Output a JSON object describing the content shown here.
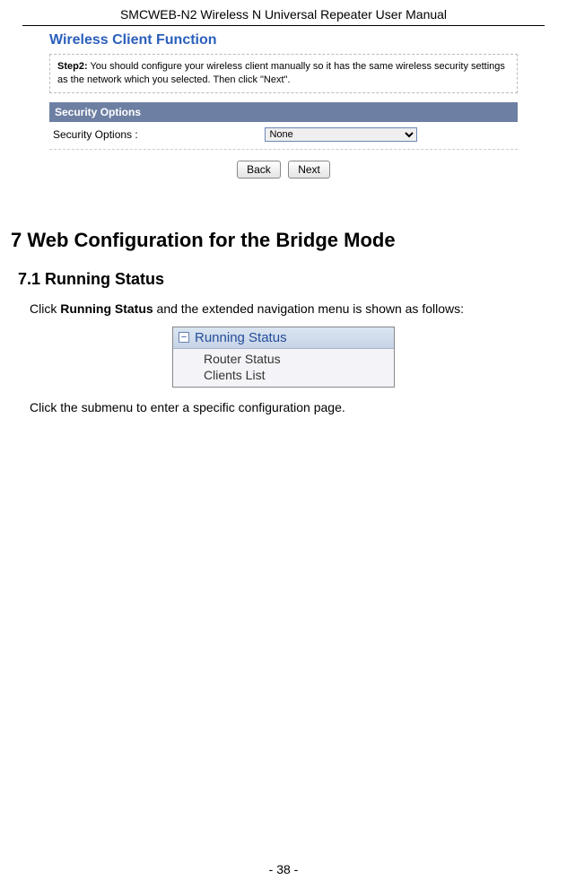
{
  "header": "SMCWEB-N2 Wireless N Universal Repeater User Manual",
  "panel": {
    "title": "Wireless Client Function",
    "stepLabel": "Step2:",
    "stepText": " You should configure your wireless client manually so it has the same wireless security settings as the network which you selected. Then click \"Next\".",
    "secOptionsHead": "Security Options",
    "secOptionsLabel": "Security Options :",
    "secOptionsValue": "None",
    "backBtn": "Back",
    "nextBtn": "Next"
  },
  "section7": {
    "h1": "7    Web Configuration for the Bridge Mode",
    "h2": "7.1   Running Status",
    "p1_a": "Click ",
    "p1_b": "Running Status",
    "p1_c": " and the extended navigation menu is shown as follows:",
    "p2": "Click the submenu to enter a specific configuration page."
  },
  "navmenu": {
    "head": "Running Status",
    "items": [
      "Router Status",
      "Clients List"
    ]
  },
  "footer": "- 38 -"
}
